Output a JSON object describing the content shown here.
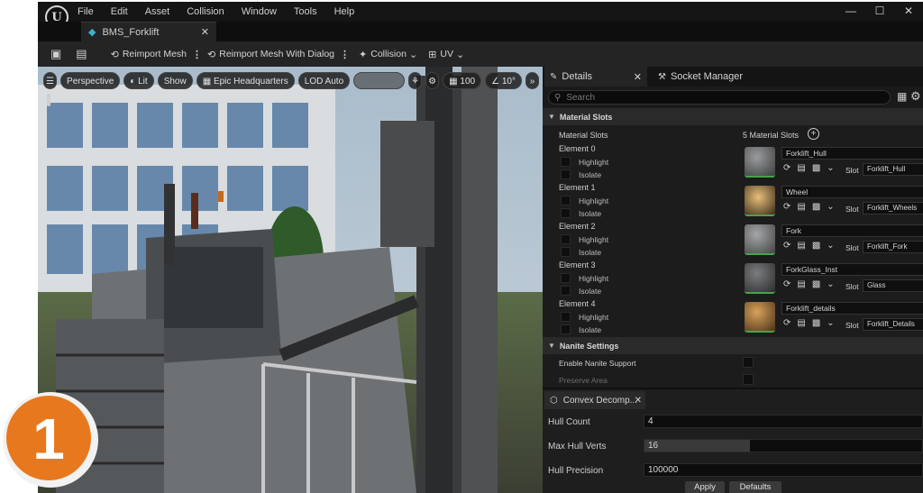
{
  "menu": [
    "File",
    "Edit",
    "Asset",
    "Collision",
    "Window",
    "Tools",
    "Help"
  ],
  "logo": "U",
  "window_controls": [
    "—",
    "☐",
    "✕"
  ],
  "tab": {
    "title": "BMS_Forklift",
    "close": "✕"
  },
  "toolbar": {
    "reimport": "Reimport Mesh",
    "reimport_dialog": "Reimport Mesh With Dialog",
    "collision": "Collision",
    "uv": "UV"
  },
  "viewport": {
    "perspective": "Perspective",
    "lit": "Lit",
    "show": "Show",
    "level": "Epic Headquarters",
    "lod": "LOD Auto",
    "grid": "100",
    "angle": "10°"
  },
  "details": {
    "tab_label": "Details",
    "socket_tab": "Socket Manager",
    "search_placeholder": "Search",
    "material_slots_header": "Material Slots",
    "material_slots_label": "Material Slots",
    "material_slots_count": "5 Material Slots",
    "highlight": "Highlight",
    "isolate": "Isolate",
    "slot": "Slot",
    "elements": [
      {
        "name": "Element 0",
        "material": "Forklift_Hull",
        "slot": "Forklift_Hull"
      },
      {
        "name": "Element 1",
        "material": "Wheel",
        "slot": "Forklift_Wheels"
      },
      {
        "name": "Element 2",
        "material": "Fork",
        "slot": "Forklift_Fork"
      },
      {
        "name": "Element 3",
        "material": "ForkGlass_Inst",
        "slot": "Glass"
      },
      {
        "name": "Element 4",
        "material": "Forklift_details",
        "slot": "Forklift_Details"
      }
    ],
    "nanite_header": "Nanite Settings",
    "nanite_enable": "Enable Nanite Support",
    "preserve_area": "Preserve Area"
  },
  "convex": {
    "tab_label": "Convex Decomp...",
    "hull_count_label": "Hull Count",
    "hull_count": "4",
    "max_verts_label": "Max Hull Verts",
    "max_verts": "16",
    "max_verts_fill": 0.38,
    "precision_label": "Hull Precision",
    "precision": "100000",
    "apply": "Apply",
    "defaults": "Defaults"
  },
  "badge": "1",
  "colors": {
    "badge": "#e8781e",
    "accent": "#47a447"
  }
}
